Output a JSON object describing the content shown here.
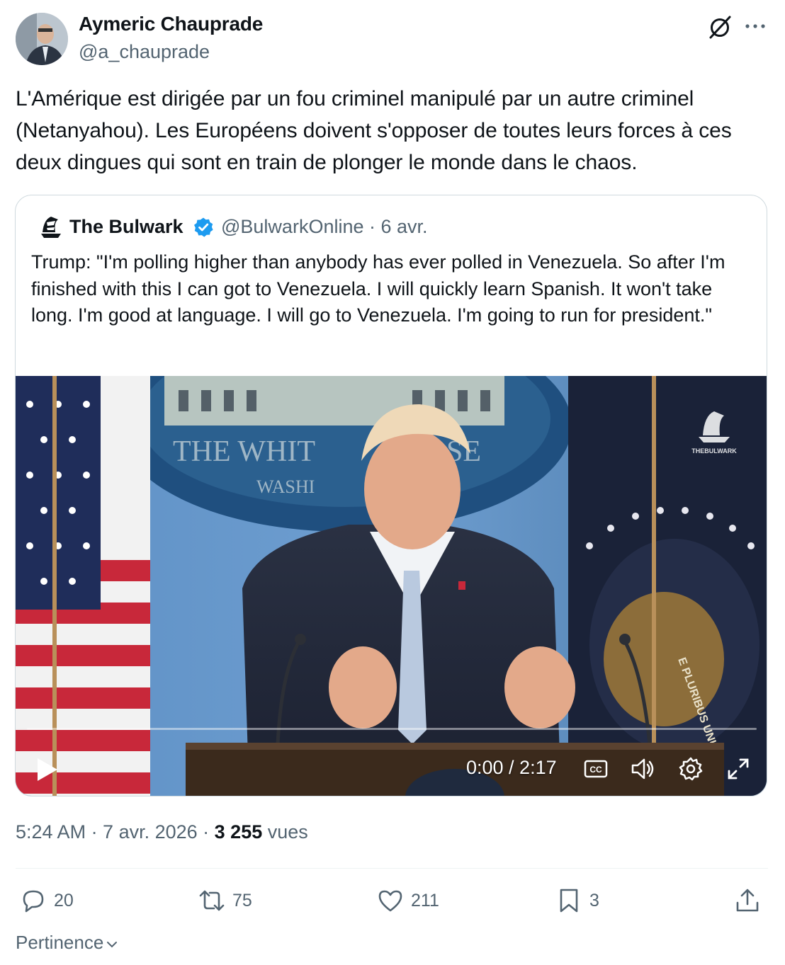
{
  "author": {
    "name": "Aymeric Chauprade",
    "handle": "@a_chauprade"
  },
  "tweet": {
    "text": "L'Amérique est dirigée par un fou criminel manipulé par un autre criminel (Netanyahou). Les Européens doivent s'opposer de toutes leurs forces à ces deux dingues qui sont en train de plonger le monde dans le chaos."
  },
  "quote": {
    "name": "The Bulwark",
    "handle_date": "@BulwarkOnline · 6 avr.",
    "text": "Trump: \"I'm polling higher than anybody has ever polled in Venezuela. So after I'm finished with this I can got to Venezuela. I will quickly learn Spanish. It won't take long. I'm good at language. I will go to Venezuela. I'm going to run for president.\"",
    "video": {
      "time": "0:00 / 2:17",
      "progress_fraction": 0,
      "watermark": "THEBULWARK",
      "seal_text_left": "THE WHIT",
      "seal_text_right": "SE",
      "seal_subtext": "WASHI",
      "eagle_text": "E PLURIBUS UNUM"
    }
  },
  "meta": {
    "time_date": "5:24 AM · 7 avr. 2026 · ",
    "views_count": "3 255",
    "views_label": " vues"
  },
  "actions": {
    "replies": "20",
    "reposts": "75",
    "likes": "211",
    "bookmarks": "3"
  },
  "sort": {
    "label": "Pertinence"
  },
  "colors": {
    "text": "#0f1419",
    "secondary": "#536471",
    "verified": "#1d9bf0",
    "border": "#cfd9de"
  }
}
